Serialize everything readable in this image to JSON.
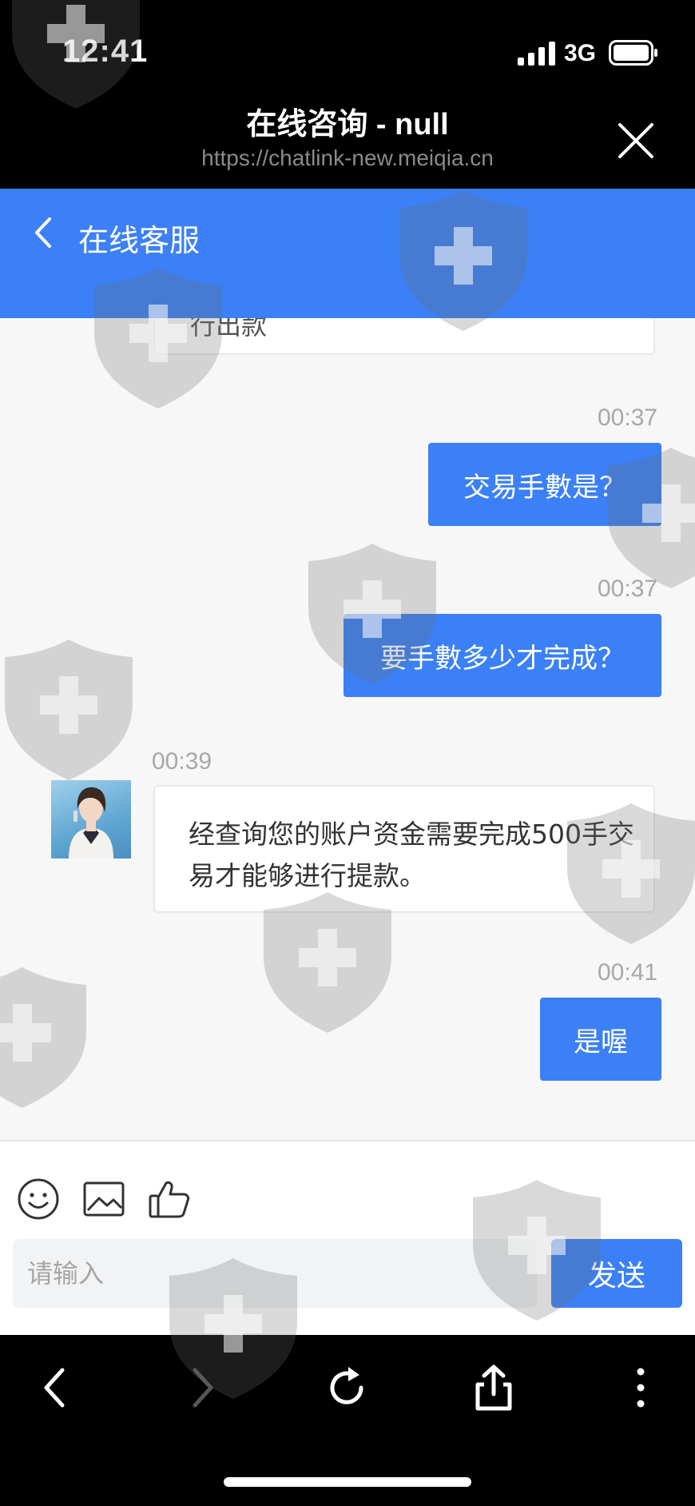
{
  "status_bar": {
    "time": "12:41",
    "network": "3G"
  },
  "browser": {
    "title": "在线咨询 - null",
    "url": "https://chatlink-new.meiqia.cn"
  },
  "header": {
    "title": "在线客服"
  },
  "messages": {
    "partial_text": "行出款",
    "m1": {
      "time": "00:37",
      "text": "交易手數是？"
    },
    "m2": {
      "time": "00:37",
      "text": "要手數多少才完成？"
    },
    "m3": {
      "time": "00:39",
      "text": "经查询您的账户资金需要完成500手交易才能够进行提款。"
    },
    "m4": {
      "time": "00:41",
      "text": "是喔"
    }
  },
  "input": {
    "placeholder": "请输入",
    "value": ""
  },
  "send_label": "发送",
  "icons": [
    "emoji-icon",
    "image-icon",
    "thumbs-up-icon",
    "back-icon",
    "forward-icon",
    "reload-icon",
    "share-icon",
    "more-icon"
  ],
  "colors": {
    "accent": "#3b80f6",
    "chat_bg": "#f7f7f7",
    "bar": "#000000"
  }
}
